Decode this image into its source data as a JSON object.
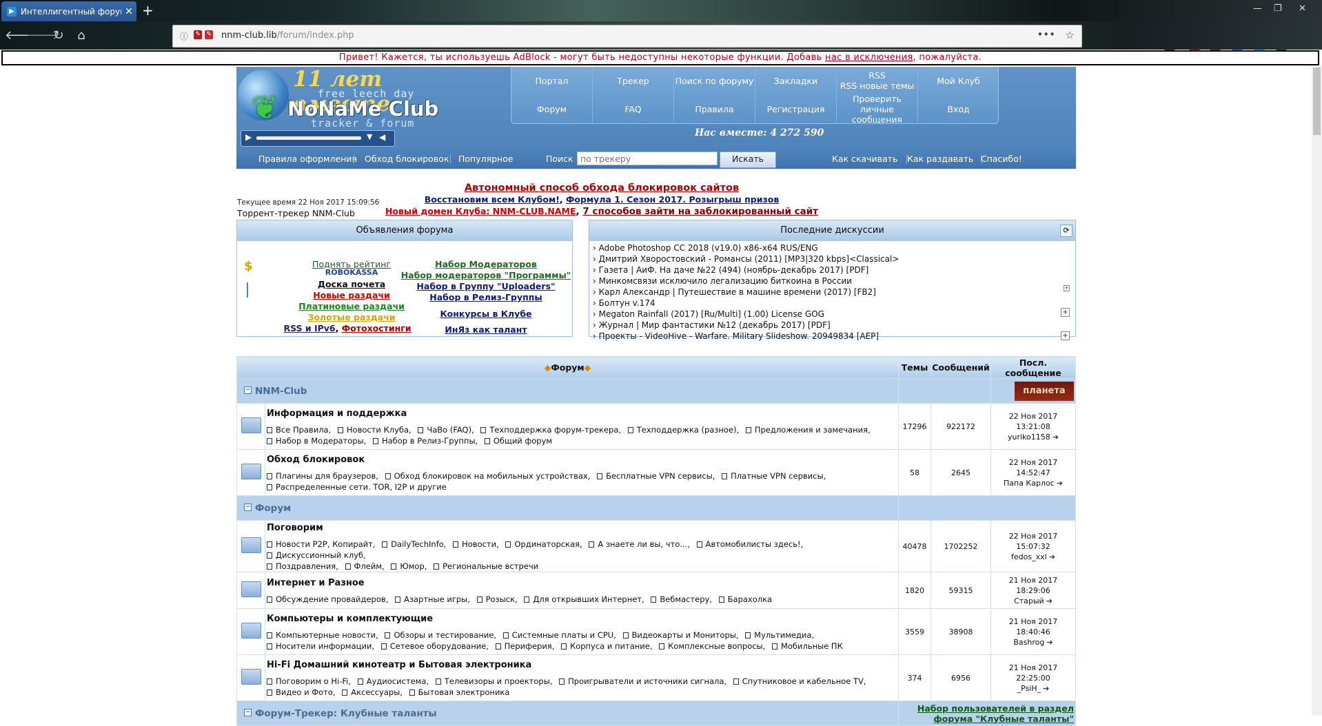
{
  "browser": {
    "tab_title": "Интеллигентный форум",
    "url_host": "nnm-club.lib",
    "url_path": "/forum/index.php",
    "new_tab": "+",
    "ext_badges": {
      "ublock": "4",
      "other": "1"
    }
  },
  "adblock_notice": {
    "text_before": "Привет! Кажется, ты используешь AdBlock - могут быть недоступны некоторые функции. Добавь ",
    "link": "нас в исключения",
    "text_after": ", пожалуйста."
  },
  "header": {
    "logo_years": "11 лет вместе",
    "logo_free": "free leech day",
    "logo_name": "NoNaMe Club",
    "logo_sub": "tracker & forum",
    "members": "Нас вместе: 4 272 590",
    "nav": [
      {
        "label": "Портал"
      },
      {
        "label": "Трекер"
      },
      {
        "label": "Поиск по форуму"
      },
      {
        "label": "Закладки"
      },
      {
        "label": "RSS\nRSS новые темы"
      },
      {
        "label": "Мой Клуб"
      },
      {
        "label": "Форум"
      },
      {
        "label": "FAQ"
      },
      {
        "label": "Правила"
      },
      {
        "label": "Регистрация"
      },
      {
        "label": "Проверить личные сообщения"
      },
      {
        "label": "Вход"
      }
    ],
    "subnav_left": [
      "Правила оформления",
      "Обход блокировок",
      "Популярное"
    ],
    "search_label": "Поиск :",
    "search_placeholder": "по трекеру",
    "search_button": "Искать",
    "subnav_right": [
      "Как скачивать",
      "Как раздавать",
      "Спасибо!"
    ]
  },
  "info": {
    "time": "Текущее время 22 Ноя 2017 15:09:56",
    "site": "Торрент-трекер NNM-Club",
    "headline": "Автономный способ обхода блокировок сайтов",
    "line2_a": "Восстановим всем Клубом!",
    "line2_sep": ",",
    "line2_b": "Формула 1. Сезон 2017. Розыгрыш призов",
    "line3_a": "Новый домен Клуба: NNM-CLUB.NAME",
    "line3_sep": ",",
    "line3_b": "7 способов зайти на заблокированный сайт"
  },
  "announcements": {
    "title": "Объявления форума",
    "dollar": "$",
    "raise": "Поднять рейтинг",
    "robokassa": "ROBOKASSA",
    "honor": "Доска почета",
    "new": "Новые раздачи",
    "paid": "Платиновые раздачи",
    "gold": "Золотые раздачи",
    "rss": "RSS и IPv6",
    "rss_sep": ",",
    "photo": "Фотохостинги",
    "mods": "Набор Модераторов",
    "mods_prog": "Набор модераторов \"Программы\"",
    "uploaders": "Набор в Группу \"Uploaders\"",
    "release": "Набор в Релиз-Группы",
    "contests": "Конкурсы в Клубе",
    "inyaz": "ИнЯз как талант"
  },
  "discussions": {
    "title": "Последние дискуссии",
    "items": [
      "Adobe Photoshop CC 2018 (v19.0) x86-x64 RUS/ENG",
      "Дмитрий Хворостовский - Романсы (2011) [MP3|320 kbps]<Classical>",
      "Газета | АиФ. На даче №22 (494) (ноябрь-декабрь 2017) [PDF]",
      "Минкомсвязи исключило легализацию биткоина в России",
      "Карл Александр | Путешествие в машине времени (2017) [FB2]",
      "Болтун v.174",
      "Megaton Rainfall (2017) [Ru/Multi] (1.00) License GOG",
      "Журнал | Мир фантастики №12 (декабрь 2017) [PDF]",
      "Проекты - VideoHive - Warfare. Military Slideshow. 20949834 [AEP]"
    ]
  },
  "forum": {
    "col_forum": "Форум",
    "col_topics": "Темы",
    "col_posts": "Сообщений",
    "col_last": "Посл. сообщение",
    "cat1": "NNM-Club",
    "cat2": "Форум",
    "cat3": "Форум-Трекер: Клубные таланты",
    "cat3_link_1": "Набор пользователей в раздел",
    "cat3_link_2": "форума \"Клубные таланты\"",
    "banner": "планета",
    "rows": [
      {
        "name": "Информация и поддержка",
        "subs": [
          "Все Правила",
          "Новости Клуба",
          "ЧаВо (FAQ)",
          "Техподдержка форум-трекера",
          "Техподдержка (разное)",
          "Предложения и замечания",
          "Набор в Модераторы",
          "Набор в Релиз-Группы",
          "Общий форум"
        ],
        "topics": "17296",
        "posts": "922172",
        "last_date": "22 Ноя 2017 13:21:08",
        "last_user": "yuriko1158"
      },
      {
        "name": "Обход блокировок",
        "subs": [
          "Плагины для браузеров",
          "Обход блокировок на мобильных устройствах",
          "Бесплатные VPN сервисы",
          "Платные VPN сервисы",
          "Распределенные сети. TOR, I2P и другие"
        ],
        "topics": "58",
        "posts": "2645",
        "last_date": "22 Ноя 2017 14:52:47",
        "last_user": "Папа Карлос"
      },
      {
        "name": "Поговорим",
        "subs": [
          "Новости P2P, Копирайт",
          "DailyTechInfo",
          "Новости",
          "Ординаторская",
          "А знаете ли вы, что...",
          "Автомобилисты здесь!",
          "Дискуссионный клуб",
          "Поздравления",
          "Флейм",
          "Юмор",
          "Региональные встречи"
        ],
        "topics": "40478",
        "posts": "1702252",
        "last_date": "22 Ноя 2017 15:07:32",
        "last_user": "fedos_xxl"
      },
      {
        "name": "Интернет и Разное",
        "subs": [
          "Обсуждение провайдеров",
          "Азартные игры",
          "Розыск",
          "Для открывших Интернет",
          "Вебмастеру",
          "Барахолка"
        ],
        "topics": "1820",
        "posts": "59315",
        "last_date": "21 Ноя 2017 18:29:06",
        "last_user": "Старый"
      },
      {
        "name": "Компьютеры и комплектующие",
        "subs": [
          "Компьютерные новости",
          "Обзоры и тестирование",
          "Системные платы и CPU",
          "Видеокарты и Мониторы",
          "Мультимедиа",
          "Носители информации",
          "Сетевое оборудование",
          "Периферия",
          "Корпуса и питание",
          "Комплексные вопросы",
          "Мобильные ПК"
        ],
        "topics": "3559",
        "posts": "38908",
        "last_date": "21 Ноя 2017 18:40:46",
        "last_user": "Bashrog"
      },
      {
        "name": "Hi-Fi Домашний кинотеатр и Бытовая электроника",
        "subs": [
          "Поговорим о Hi-Fi",
          "Аудиосистема",
          "Телевизоры и проекторы",
          "Проигрыватели и источники сигнала",
          "Спутниковое и кабельное TV",
          "Видео и Фото",
          "Аксессуары",
          "Бытовая электроника"
        ],
        "topics": "374",
        "posts": "6956",
        "last_date": "21 Ноя 2017 22:25:00",
        "last_user": "_PsiH_"
      }
    ]
  },
  "colors": {
    "header_blue": "#5f93c8",
    "alert_red": "#c00018",
    "cat_bg": "#b9d2ec"
  }
}
